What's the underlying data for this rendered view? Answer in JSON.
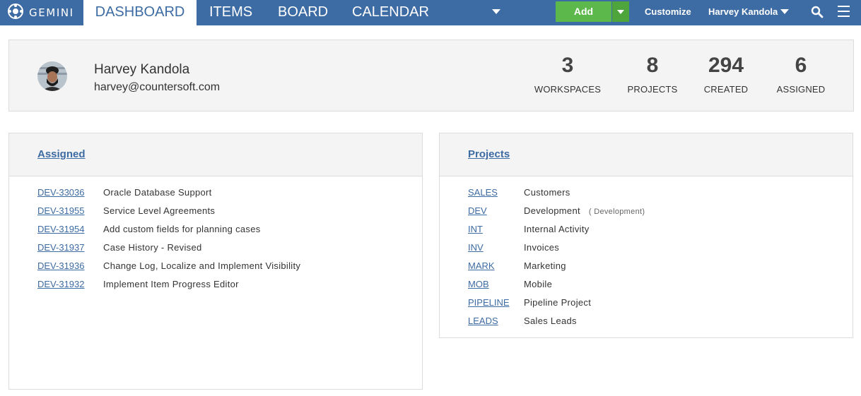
{
  "nav": {
    "logo_text": "GEMINI",
    "tabs": [
      {
        "label": "DASHBOARD",
        "active": true
      },
      {
        "label": "ITEMS",
        "active": false
      },
      {
        "label": "BOARD",
        "active": false
      },
      {
        "label": "CALENDAR",
        "active": false
      }
    ],
    "add_label": "Add",
    "customize_label": "Customize",
    "user_label": "Harvey Kandola",
    "icons": [
      "gemini-logo-icon",
      "chevron-down-icon",
      "search-icon",
      "hamburger-menu-icon"
    ],
    "colors": {
      "nav_bg": "#3d6ba3",
      "add_green": "#5cb84a",
      "link": "#3d6ba3"
    }
  },
  "profile": {
    "name": "Harvey Kandola",
    "email": "harvey@countersoft.com",
    "stats": [
      {
        "value": "3",
        "label": "WORKSPACES"
      },
      {
        "value": "8",
        "label": "PROJECTS"
      },
      {
        "value": "294",
        "label": "CREATED"
      },
      {
        "value": "6",
        "label": "ASSIGNED"
      }
    ]
  },
  "assigned": {
    "title": "Assigned",
    "items": [
      {
        "id": "DEV-33036",
        "title": "Oracle Database Support"
      },
      {
        "id": "DEV-31955",
        "title": "Service Level Agreements"
      },
      {
        "id": "DEV-31954",
        "title": "Add custom fields for planning cases"
      },
      {
        "id": "DEV-31937",
        "title": "Case History - Revised"
      },
      {
        "id": "DEV-31936",
        "title": "Change Log, Localize and Implement Visibility"
      },
      {
        "id": "DEV-31932",
        "title": "Implement Item Progress Editor"
      }
    ]
  },
  "projects": {
    "title": "Projects",
    "items": [
      {
        "code": "SALES",
        "name": "Customers",
        "note": ""
      },
      {
        "code": "DEV",
        "name": "Development",
        "note": "( Development)"
      },
      {
        "code": "INT",
        "name": "Internal Activity",
        "note": ""
      },
      {
        "code": "INV",
        "name": "Invoices",
        "note": ""
      },
      {
        "code": "MARK",
        "name": "Marketing",
        "note": ""
      },
      {
        "code": "MOB",
        "name": "Mobile",
        "note": ""
      },
      {
        "code": "PIPELINE",
        "name": "Pipeline Project",
        "note": ""
      },
      {
        "code": "LEADS",
        "name": "Sales Leads",
        "note": ""
      }
    ]
  }
}
